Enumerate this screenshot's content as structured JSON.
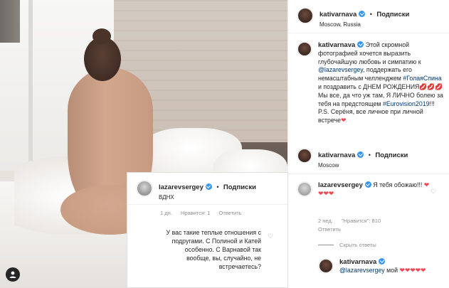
{
  "post": {
    "author": "kativarnava",
    "follow_label": "Подписки",
    "location": "Moscow, Russia",
    "caption_author": "kativarnava",
    "caption_parts": [
      {
        "text": "Этой скромной фотографией хочется выразить глубочайшую любовь и симпатию к ",
        "type": "text"
      },
      {
        "text": "@lazarevsergey",
        "type": "link"
      },
      {
        "text": ", поддержать его немасштабным челленджем ",
        "type": "text"
      },
      {
        "text": "#ГолаяСпина",
        "type": "link"
      },
      {
        "text": " и поздравить с ДНЕМ РОЖДЕНИЯ",
        "type": "text"
      },
      {
        "text": "💋💋💋",
        "type": "emoji"
      },
      {
        "text": " Мы все, да что уж там, Я ЛИЧНО болею за тебя на предстоящем ",
        "type": "text"
      },
      {
        "text": "#Eurovision2019",
        "type": "link"
      },
      {
        "text": "!!! P.S. Серёня, все личное при личной встрече",
        "type": "text"
      },
      {
        "text": "❤",
        "type": "heart"
      }
    ]
  },
  "repost": {
    "author": "kativarnava",
    "follow_label": "Подписки",
    "location": "Moscow"
  },
  "comment_lazarev": {
    "author": "lazarevsergey",
    "text": "Я тебя обожаю!!! ",
    "hearts": "❤❤❤❤",
    "age": "2 нед.",
    "likes": "\"Нравится\": 810",
    "reply_label": "Ответить"
  },
  "hide_replies": "Скрыть ответы",
  "reply_kati": {
    "author": "kativarnava",
    "mention": "@lazarevsergey",
    "text": " мой ",
    "hearts": "❤❤❤❤❤"
  },
  "card": {
    "author": "lazarevsergey",
    "follow_label": "Подписки",
    "location": "ВДНХ",
    "age": "1 дн.",
    "likes": "Нравится: 1",
    "reply_label": "Ответить",
    "comment": "У вас такие теплые отношения с подругами. С Полиной и Катей особенно. С Варнавой так вообще, вы, случайно, не встречаетесь?"
  },
  "icons": {
    "verified": "verified-badge-icon",
    "heart_outline": "heart-outline-icon",
    "user_tag": "user-tag-icon"
  },
  "colors": {
    "verified_blue": "#3897f0",
    "link_blue": "#00376b",
    "heart_red": "#ed4956",
    "meta_gray": "#8e8e8e"
  }
}
